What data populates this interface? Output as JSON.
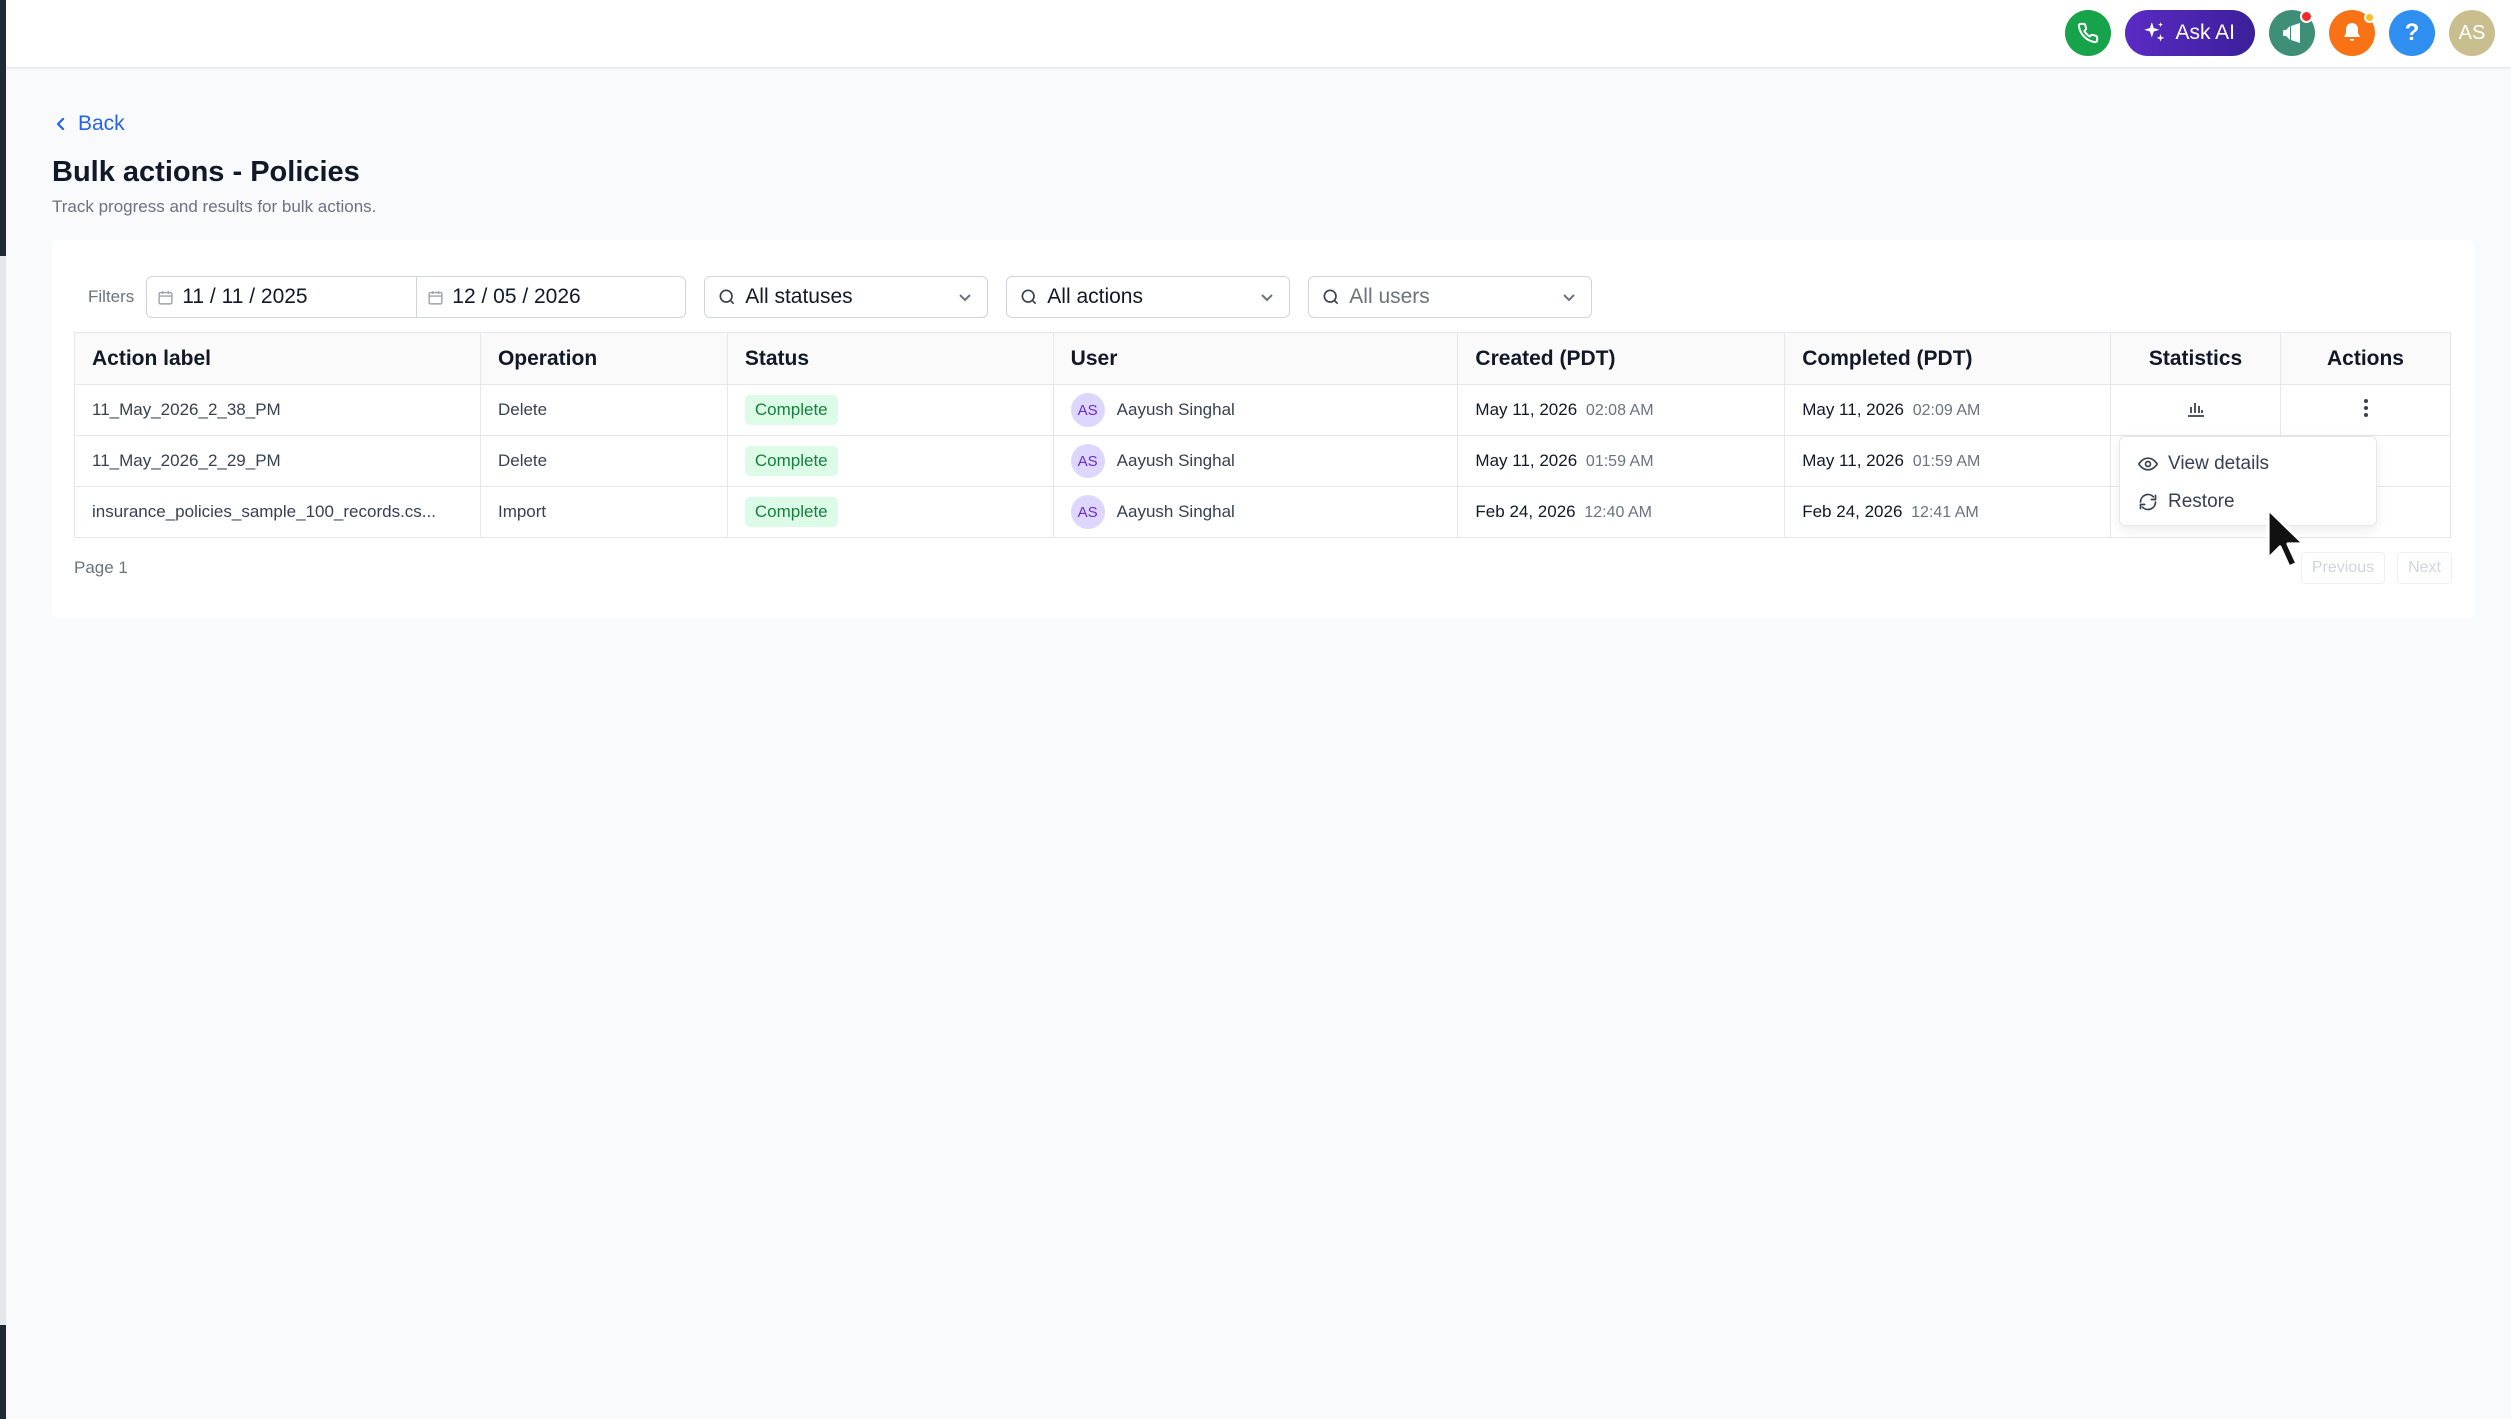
{
  "header": {
    "ask_ai_label": "Ask AI",
    "user_initials": "AS",
    "help_label": "?"
  },
  "page": {
    "back_label": "Back",
    "title": "Bulk actions - Policies",
    "subtitle": "Track progress and results for bulk actions."
  },
  "filters": {
    "label": "Filters",
    "start_date": "11 / 11 / 2025",
    "end_date": "12 / 05 / 2026",
    "status_value": "All statuses",
    "action_value": "All actions",
    "user_placeholder": "All users"
  },
  "table": {
    "columns": [
      "Action label",
      "Operation",
      "Status",
      "User",
      "Created (PDT)",
      "Completed (PDT)",
      "Statistics",
      "Actions"
    ],
    "rows": [
      {
        "action_label": "11_May_2026_2_38_PM",
        "operation": "Delete",
        "status": "Complete",
        "user_initials": "AS",
        "user_name": "Aayush Singhal",
        "created_date": "May 11, 2026",
        "created_time": "02:08 AM",
        "completed_date": "May 11, 2026",
        "completed_time": "02:09 AM"
      },
      {
        "action_label": "11_May_2026_2_29_PM",
        "operation": "Delete",
        "status": "Complete",
        "user_initials": "AS",
        "user_name": "Aayush Singhal",
        "created_date": "May 11, 2026",
        "created_time": "01:59 AM",
        "completed_date": "May 11, 2026",
        "completed_time": "01:59 AM"
      },
      {
        "action_label": "insurance_policies_sample_100_records.cs...",
        "operation": "Import",
        "status": "Complete",
        "user_initials": "AS",
        "user_name": "Aayush Singhal",
        "created_date": "Feb 24, 2026",
        "created_time": "12:40 AM",
        "completed_date": "Feb 24, 2026",
        "completed_time": "12:41 AM"
      }
    ]
  },
  "pagination": {
    "page_label": "Page 1",
    "previous_label": "Previous",
    "next_label": "Next"
  },
  "menu": {
    "view_details_label": "View details",
    "restore_label": "Restore"
  },
  "colors": {
    "accent": "#2563eb",
    "success_bg": "#dcfce7",
    "success_text": "#15803d",
    "ask_ai": "#4c25b0"
  }
}
